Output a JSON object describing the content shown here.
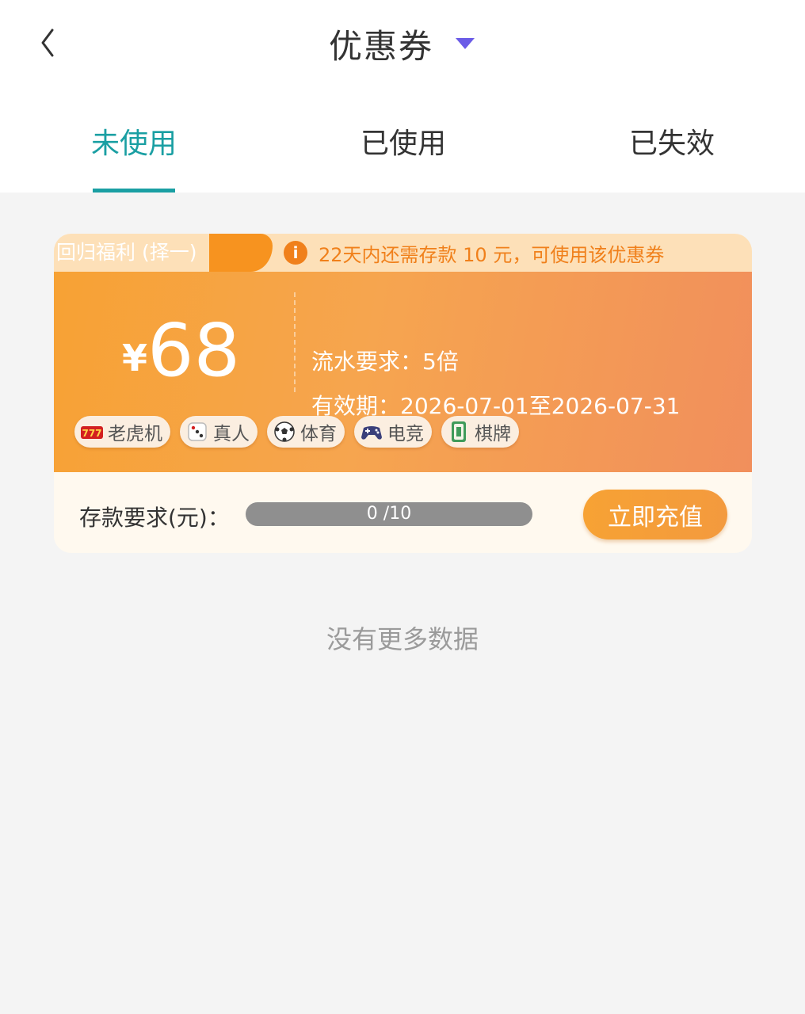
{
  "header": {
    "back_icon": "chevron-left-icon",
    "title": "优惠券",
    "dropdown_icon": "caret-down-icon",
    "dropdown_color": "#6b5ce7"
  },
  "tabs": [
    {
      "label": "未使用",
      "active": true
    },
    {
      "label": "已使用",
      "active": false
    },
    {
      "label": "已失效",
      "active": false
    }
  ],
  "accent_color": "#1a9fa3",
  "coupon": {
    "badge": "回归福利 (择一)",
    "notice": "22天内还需存款 10 元，可使用该优惠券",
    "currency": "¥",
    "amount": "68",
    "wager_requirement": "流水要求：5倍",
    "validity": "有效期：2026-07-01至2026-07-31",
    "categories": [
      {
        "icon": "slot-machine-icon",
        "label": "老虎机"
      },
      {
        "icon": "dice-icon",
        "label": "真人"
      },
      {
        "icon": "soccer-ball-icon",
        "label": "体育"
      },
      {
        "icon": "gamepad-icon",
        "label": "电竞"
      },
      {
        "icon": "mahjong-tile-icon",
        "label": "棋牌"
      }
    ],
    "deposit_label": "存款要求(元)：",
    "progress_text": "0 /10",
    "progress_value": 0,
    "progress_max": 10,
    "recharge_button": "立即充值"
  },
  "footer_message": "没有更多数据"
}
